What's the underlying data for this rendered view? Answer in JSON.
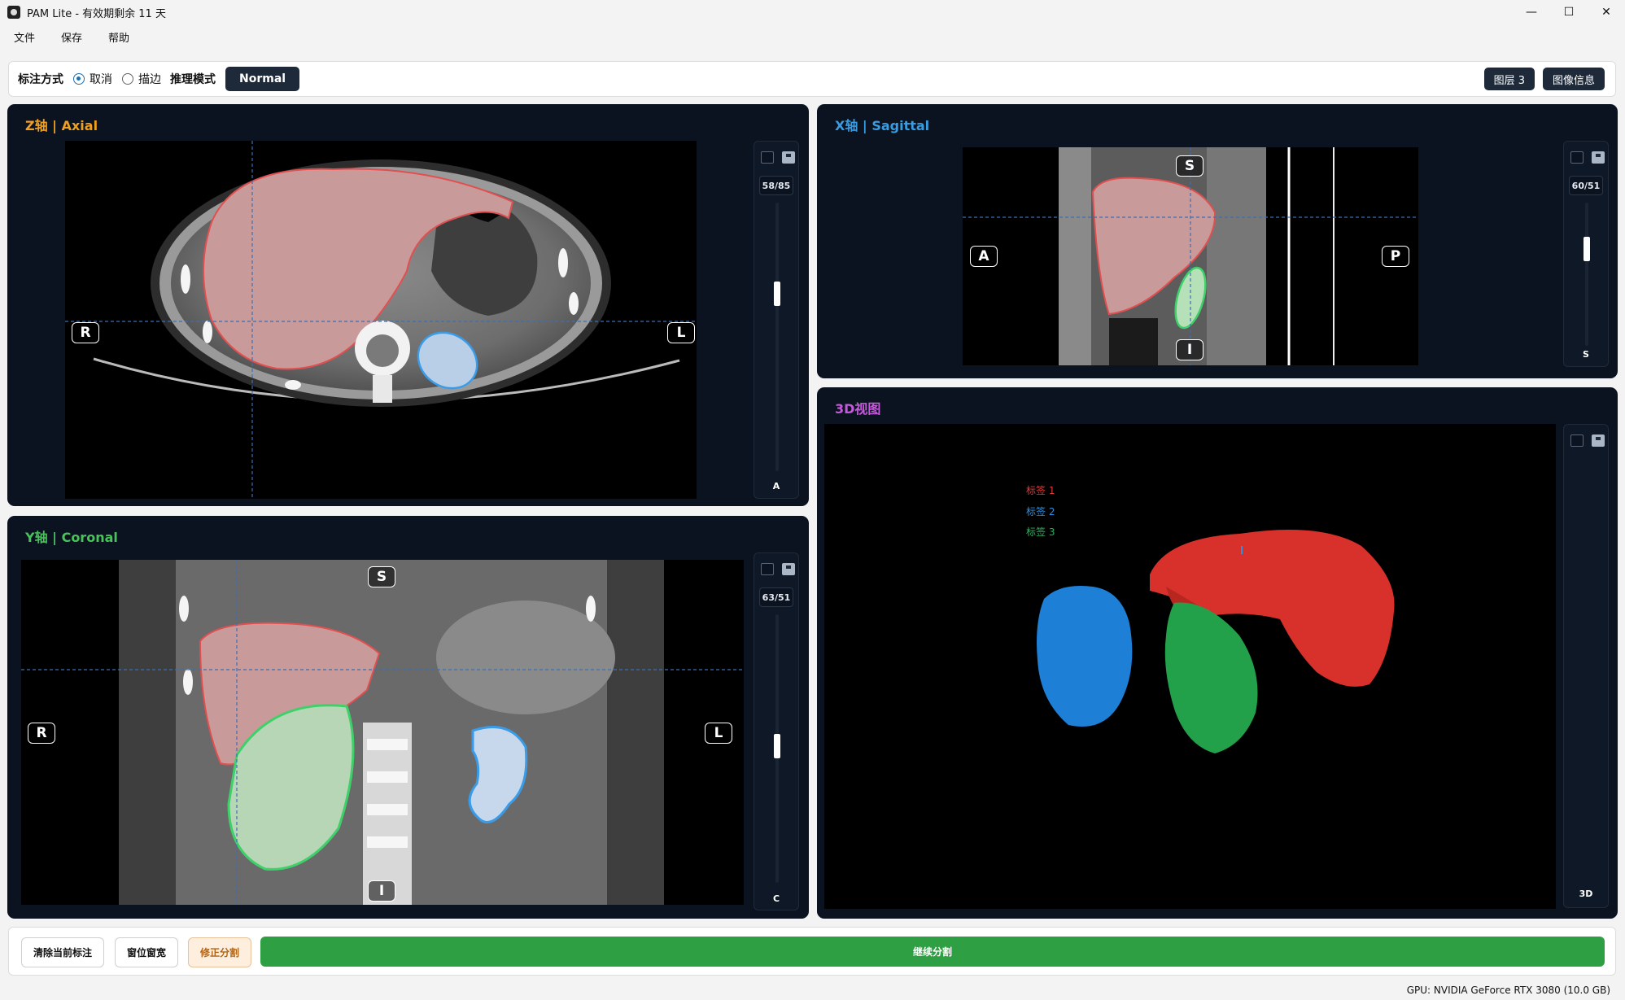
{
  "window": {
    "title": "PAM Lite - 有效期剩余 11 天",
    "controls": [
      "—",
      "☐",
      "✕"
    ]
  },
  "menu": [
    "文件",
    "保存",
    "帮助"
  ],
  "toolbar": {
    "annotation_label": "标注方式",
    "radio_cancel": "取消",
    "radio_outline": "描边",
    "selected_radio": "取消",
    "inference_label": "推理模式",
    "mode_button": "Normal",
    "layers_button": "图层 3",
    "image_info_button": "图像信息"
  },
  "panels": {
    "axial": {
      "title": "Z轴 | Axial",
      "title_color": "#f0a020",
      "slice": "58/85",
      "axis_letter": "A",
      "slider_position": 0.33,
      "orientation": {
        "left": "R",
        "right": "L"
      }
    },
    "sagittal": {
      "title": "X轴 | Sagittal",
      "title_color": "#3a9ce0",
      "slice": "60/51",
      "axis_letter": "S",
      "slider_position": 0.3,
      "orientation": {
        "left": "A",
        "right": "P",
        "top": "S",
        "bottom": "I"
      }
    },
    "coronal": {
      "title": "Y轴 | Coronal",
      "title_color": "#49c25a",
      "slice": "63/51",
      "axis_letter": "C",
      "slider_position": 0.47,
      "orientation": {
        "left": "R",
        "right": "L",
        "top": "S",
        "bottom": "I"
      }
    },
    "view3d": {
      "title": "3D视图",
      "title_color": "#c35ad8",
      "axis_letter": "3D",
      "legend": [
        {
          "label": "标签 1",
          "color": "#e03a3a"
        },
        {
          "label": "标签 2",
          "color": "#2f8fe0"
        },
        {
          "label": "标签 3",
          "color": "#2fb060"
        }
      ]
    }
  },
  "bottom": {
    "clear_button": "清除当前标注",
    "window_button": "窗位窗宽",
    "fix_button": "修正分割",
    "continue_button": "继续分割"
  },
  "status": {
    "gpu": "GPU: NVIDIA GeForce RTX 3080 (10.0 GB)"
  },
  "colors": {
    "liver": "#e05050",
    "spleen_kidney_blue": "#3a9ce8",
    "kidney_green": "#3fd06a",
    "accent_green": "#2ea043"
  }
}
